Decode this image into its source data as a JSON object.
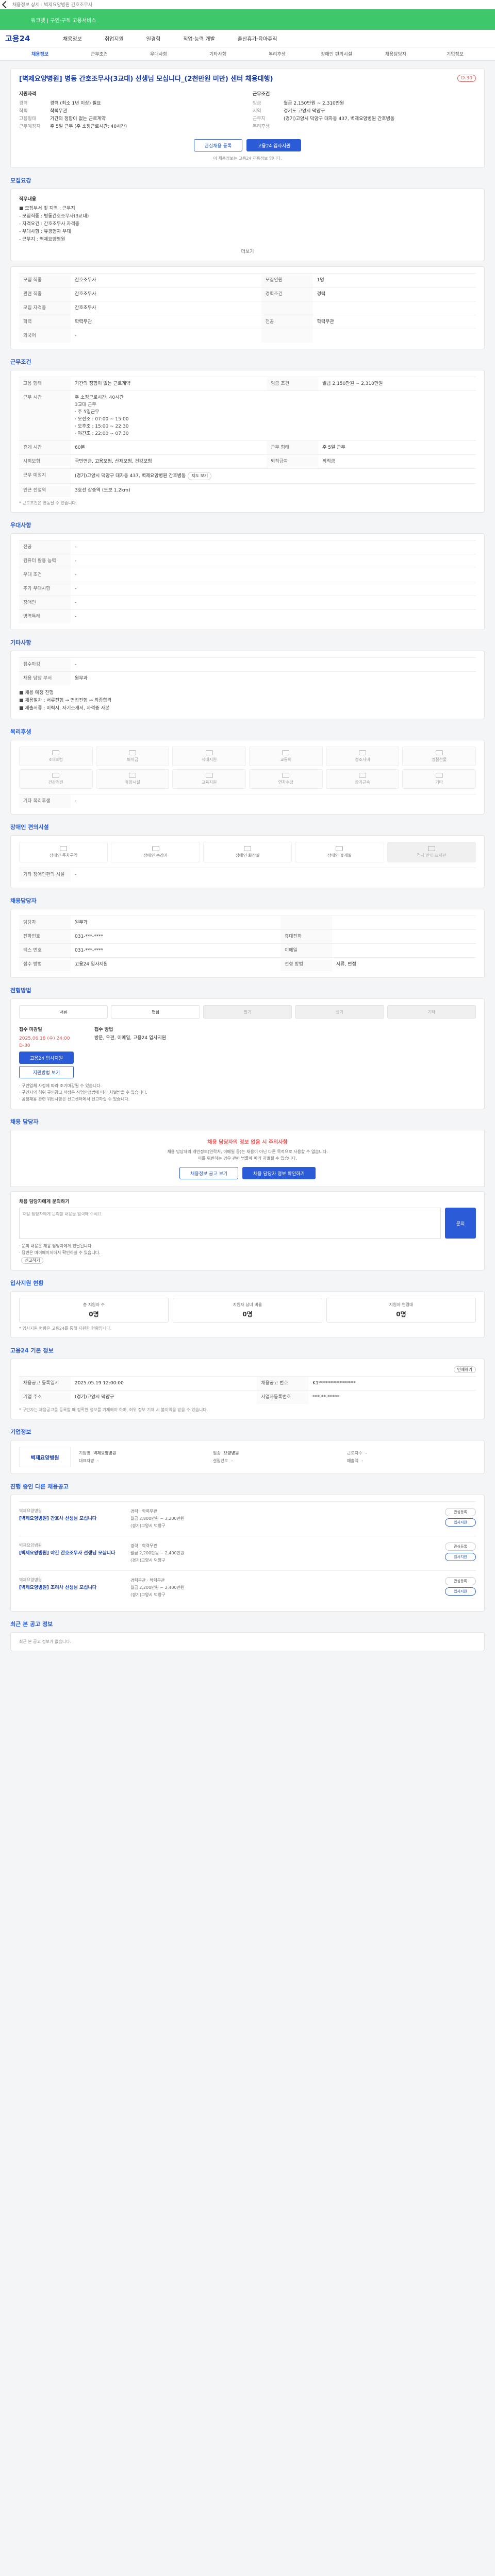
{
  "topbar": {
    "title": "채용정보 상세 : 벽제요양병원 간호조무사"
  },
  "banner": {
    "text": "워크넷 | 구인·구직 고용서비스"
  },
  "nav": {
    "logo": "고용24",
    "items": [
      "채용정보",
      "취업지원",
      "일경험",
      "직업·능력 개발",
      "출산휴가·육아휴직"
    ]
  },
  "subnav": {
    "tabs": [
      "채용정보",
      "근무조건",
      "우대사항",
      "기타사항",
      "복리후생",
      "장애인 편의시설",
      "채용담당자",
      "기업정보"
    ],
    "active": 0
  },
  "summary": {
    "title": "[벽제요양병원] 병동 간호조무사(3교대) 선생님 모십니다_(2천만원 미만) 센터 채용대행)",
    "dday": "D-30",
    "left_head": "지원자격",
    "right_head": "근무조건",
    "left_rows": [
      {
        "k": "경력",
        "v": "경력 (최소 1년 이상) 필요"
      },
      {
        "k": "학력",
        "v": "학력무관"
      },
      {
        "k": "고용형태",
        "v": ""
      },
      {
        "k": "고용형태",
        "v": "기간의 정함이 없는 근로계약"
      },
      {
        "k": "근무예정지",
        "v": "주 5일 근무 (주 소정근로시간: 40시간)"
      }
    ],
    "right_rows": [
      {
        "k": "임금",
        "v": "월급 2,150만원 ~ 2,310만원"
      },
      {
        "k": "지역",
        "v": "경기도 고양시 덕양구"
      },
      {
        "k": "근무지",
        "v": "(경기)고양시 덕양구 대자동 437, 벽제요양병원 간호병동"
      },
      {
        "k": "복리후생",
        "v": ""
      }
    ],
    "btn_scrap": "관심채용 등록",
    "btn_apply": "고용24 입사지원",
    "note": "이 채용정보는 고용24 채용정보 입니다."
  },
  "recruit": {
    "title": "모집요강",
    "duty_head": "직무내용",
    "duty_text": "■ 모집부서 및 지역 : 근무지\n- 모집직종 : 병동간호조무사(3교대)\n- 자격요건 : 간호조무사 자격증\n- 우대사항 : 유경험자 우대\n- 근무지 : 벽제요양병원",
    "toggle": "더보기",
    "rows": [
      {
        "k": "모집 직종",
        "v": "간호조무사",
        "k2": "모집인원",
        "v2": "1명"
      },
      {
        "k": "관련 직종",
        "v": "간호조무사",
        "k2": "경력조건",
        "v2": "경력"
      },
      {
        "k": "모집 자격증",
        "v": "간호조무사",
        "k2": "",
        "v2": ""
      },
      {
        "k": "학력",
        "v": "학력무관",
        "k2": "전공",
        "v2": "학력무관"
      },
      {
        "k": "외국어",
        "v": "-",
        "k2": "",
        "v2": ""
      }
    ]
  },
  "condition": {
    "title": "근무조건",
    "rows": [
      {
        "k": "고용 형태",
        "v": "기간의 정함이 없는 근로계약",
        "k2": "임금 조건",
        "v2": "월급 2,150만원 ~ 2,310만원"
      },
      {
        "k": "근무 시간",
        "v": "주 소정근로시간: 40시간\n3교대 근무\n· 주 5일근무\n· 오전조 : 07:00 ~ 15:00\n· 오후조 : 15:00 ~ 22:30\n· 야간조 : 22:00 ~ 07:30",
        "k2": "",
        "v2": ""
      },
      {
        "k": "휴게 시간",
        "v": "60분",
        "k2": "근무 형태",
        "v2": "주 5일 근무"
      },
      {
        "k": "사회보험",
        "v": "국민연금, 고용보험, 산재보험, 건강보험",
        "k2": "퇴직급여",
        "v2": "퇴직금"
      },
      {
        "k": "근무 예정지",
        "v": "(경기)고양시 덕양구 대자동 437, 벽제요양병원 간호병동",
        "k2": "",
        "v2": ""
      },
      {
        "k": "인근 전철역",
        "v": "3호선 삼송역 (도보 1.2km)",
        "k2": "",
        "v2": ""
      }
    ],
    "map_btn": "지도 보기",
    "note": "* 근로조건은 변동될 수 있습니다."
  },
  "preferred": {
    "title": "우대사항",
    "rows": [
      {
        "k": "전공",
        "v": "-"
      },
      {
        "k": "컴퓨터 활용 능력",
        "v": "-"
      },
      {
        "k": "우대 조건",
        "v": "-"
      },
      {
        "k": "추가 우대사항",
        "v": "-"
      },
      {
        "k": "장애인",
        "v": "-"
      },
      {
        "k": "병역특례",
        "v": "-"
      }
    ]
  },
  "etc": {
    "title": "기타사항",
    "rows": [
      {
        "k": "접수마감",
        "v": "-"
      },
      {
        "k": "채용 담당 부서",
        "v": "원무과"
      }
    ],
    "extra": "■ 채용 예정 진행\n■ 채용절차 : 서류전형 → 면접전형 → 최종합격\n■ 제출서류 : 이력서, 자기소개서, 자격증 사본"
  },
  "welfare": {
    "title": "복리후생",
    "items": [
      "4대보험",
      "퇴직금",
      "식대지원",
      "교통비",
      "경조사비",
      "명절선물",
      "건강검진",
      "휴양시설",
      "교육지원",
      "연차수당",
      "장기근속",
      "기타"
    ],
    "detail_head": "기타 복리후생",
    "detail": "-"
  },
  "facility": {
    "title": "장애인 편의시설",
    "items": [
      {
        "label": "장애인 주차구역",
        "on": true
      },
      {
        "label": "장애인 승강기",
        "on": true
      },
      {
        "label": "장애인 화장실",
        "on": true
      },
      {
        "label": "장애인 휴게실",
        "on": true
      },
      {
        "label": "점자 안내 표지판",
        "on": false
      }
    ],
    "detail_head": "기타 장애인편의 시설",
    "detail": "-"
  },
  "manager": {
    "title": "채용담당자",
    "rows": [
      {
        "k": "담당자",
        "v": "원무과",
        "k2": "",
        "v2": ""
      },
      {
        "k": "전화번호",
        "v": "031-***-****",
        "k2": "휴대전화",
        "v2": ""
      },
      {
        "k": "팩스 번호",
        "v": "031-***-****",
        "k2": "이메일",
        "v2": ""
      },
      {
        "k": "접수 방법",
        "v": "고용24 입사지원",
        "k2": "전형 방법",
        "v2": "서류, 면접"
      }
    ]
  },
  "apply": {
    "title": "전형방법",
    "methods": [
      {
        "label": "서류",
        "on": true
      },
      {
        "label": "면접",
        "on": true
      },
      {
        "label": "필기",
        "on": false
      },
      {
        "label": "실기",
        "on": false
      },
      {
        "label": "기타",
        "on": false
      }
    ],
    "left_head": "접수 마감일",
    "left_value": "2025.06.18 (수) 24:00",
    "left_sub": "D-30",
    "right_head": "접수 방법",
    "right_value": "방문, 우편, 이메일, 고용24 입사지원",
    "btn_apply": "고용24 입사지원",
    "btn_more": "지원방법 보기",
    "bullets": "· 구인업체 사정에 따라 조기마감될 수 있습니다.\n· 구인자의 허위 구인광고 작성은 직업안정법에 따라 처벌받을 수 있습니다.\n· 공정채용 관련 위반사항은 신고센터에서 신고하실 수 있습니다."
  },
  "qa": {
    "title": "채용 담당자",
    "warn_title": "채용 담당자의 정보 없음 시 주의사항",
    "warn_text": "채용 담당자의 개인정보(연락처, 이메일 등)는 채용이 아닌 다른 목적으로 사용할 수 없습니다.\n이를 위반하는 경우 관련 법률에 따라 처벌될 수 있습니다.",
    "btn_a": "채용정보 공고 보기",
    "btn_b": "채용 담당자 정보 확인하기",
    "qa_head": "채용 담당자에게 문의하기",
    "qa_placeholder": "채용 담당자에게 문의할 내용을 입력해 주세요.",
    "qa_btn": "문의",
    "bullets": "· 문의 내용은 채용 담당자에게 전달됩니다.\n· 답변은 마이페이지에서 확인하실 수 있습니다.",
    "report_btn": "신고하기"
  },
  "stats": {
    "title": "입사지원 현황",
    "items": [
      {
        "label": "총 지원자 수",
        "n": "0명"
      },
      {
        "label": "지원자 남녀 비율",
        "n": "0명"
      },
      {
        "label": "지원자 연령대",
        "n": "0명"
      }
    ],
    "note": "* 입사지원 현황은 고용24를 통해 지원한 현황입니다."
  },
  "meta": {
    "title": "고용24 기본 정보",
    "btn": "인쇄하기",
    "rows": [
      {
        "k": "채용공고 등록일시",
        "v": "2025.05.19 12:00:00",
        "k2": "채용공고 번호",
        "v2": "K1****************"
      },
      {
        "k": "기업 주소",
        "v": "(경기)고양시 덕양구",
        "k2": "사업자등록번호",
        "v2": "***-**-*****"
      }
    ],
    "note": "* 구인자는 채용공고를 등록할 때 정확한 정보를 기재해야 하며, 허위 정보 기재 시 불이익을 받을 수 있습니다."
  },
  "company": {
    "title": "기업정보",
    "logo": "벽제요양병원",
    "info": [
      {
        "k": "기업명",
        "v": "벽제요양병원"
      },
      {
        "k": "업종",
        "v": "요양병원"
      },
      {
        "k": "근로자수",
        "v": "-"
      },
      {
        "k": "대표자명",
        "v": "-"
      },
      {
        "k": "설립년도",
        "v": "-"
      },
      {
        "k": "매출액",
        "v": "-"
      }
    ]
  },
  "other": {
    "title": "진행 중인 다른 채용공고",
    "items": [
      {
        "org": "벽제요양병원",
        "t": "[벽제요양병원] 간호사 선생님 모십니다",
        "m": "경력 · 학력무관\n월급 2,800만원 ~ 3,200만원\n(경기)고양시 덕양구"
      },
      {
        "org": "벽제요양병원",
        "t": "[벽제요양병원] 야간 간호조무사 선생님 모십니다",
        "m": "경력 · 학력무관\n월급 2,200만원 ~ 2,400만원\n(경기)고양시 덕양구"
      },
      {
        "org": "벽제요양병원",
        "t": "[벽제요양병원] 조리사 선생님 모십니다",
        "m": "경력무관 · 학력무관\n월급 2,200만원 ~ 2,400만원\n(경기)고양시 덕양구"
      }
    ],
    "btn_a": "관심등록",
    "btn_b": "입사지원"
  },
  "recent": {
    "title": "최근 본 공고 정보",
    "text": "최근 본 공고 정보가 없습니다."
  }
}
